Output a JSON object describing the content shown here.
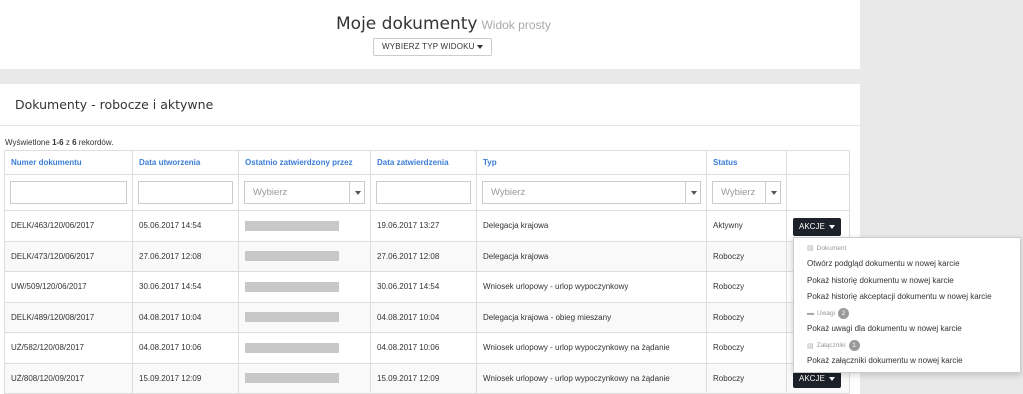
{
  "header": {
    "title": "Moje dokumenty",
    "subtitle": "Widok prosty",
    "view_button": "WYBIERZ TYP WIDOKU"
  },
  "section": {
    "title": "Dokumenty - robocze i aktywne"
  },
  "summary": {
    "prefix": "Wyświetlone ",
    "range": "1-6",
    "middle": " z ",
    "total": "6",
    "suffix": " rekordów."
  },
  "table": {
    "columns": [
      "Numer dokumentu",
      "Data utworzenia",
      "Ostatnio zatwierdzony przez",
      "Data zatwierdzenia",
      "Typ",
      "Status",
      ""
    ],
    "select_placeholder": "Wybierz",
    "rows": [
      {
        "number": "DELK/463/120/06/2017",
        "created": "05.06.2017 14:54",
        "approved_by": "",
        "approved": "19.06.2017 13:27",
        "type": "Delegacja krajowa",
        "status": "Aktywny"
      },
      {
        "number": "DELK/473/120/06/2017",
        "created": "27.06.2017 12:08",
        "approved_by": "",
        "approved": "27.06.2017 12:08",
        "type": "Delegacja krajowa",
        "status": "Roboczy"
      },
      {
        "number": "UW/509/120/06/2017",
        "created": "30.06.2017 14:54",
        "approved_by": "",
        "approved": "30.06.2017 14:54",
        "type": "Wniosek urlopowy - urlop wypoczynkowy",
        "status": "Roboczy"
      },
      {
        "number": "DELK/489/120/08/2017",
        "created": "04.08.2017 10:04",
        "approved_by": "",
        "approved": "04.08.2017 10:04",
        "type": "Delegacja krajowa - obieg mieszany",
        "status": "Roboczy"
      },
      {
        "number": "UŻ/582/120/08/2017",
        "created": "04.08.2017 10:06",
        "approved_by": "",
        "approved": "04.08.2017 10:06",
        "type": "Wniosek urlopowy - urlop wypoczynkowy na żądanie",
        "status": "Roboczy"
      },
      {
        "number": "UŻ/808/120/09/2017",
        "created": "15.09.2017 12:09",
        "approved_by": "",
        "approved": "15.09.2017 12:09",
        "type": "Wniosek urlopowy - urlop wypoczynkowy na żądanie",
        "status": "Roboczy"
      }
    ]
  },
  "actions_label": "AKCJE",
  "dropdown": {
    "document_header": "Dokument",
    "open_preview": "Otwórz podgląd dokumentu w nowej karcie",
    "show_history": "Pokaż historię dokumentu w nowej karcie",
    "show_approval_history": "Pokaż historię akceptacji dokumentu w nowej karcie",
    "notes_header": "Uwagi",
    "notes_count": "2",
    "show_notes": "Pokaż uwagi dla dokumentu w nowej karcie",
    "attachments_header": "Załączniki",
    "attachments_count": "1",
    "show_attachments": "Pokaż załączniki dokumentu w nowej karcie"
  },
  "icons": [
    "caret-down-icon",
    "document-icon",
    "comment-icon",
    "paperclip-icon"
  ],
  "colors": {
    "link_blue": "#3b7dd8",
    "dark_button": "#1d2129",
    "badge_gray": "#9a9a9a",
    "page_background": "#e9e9e9"
  }
}
